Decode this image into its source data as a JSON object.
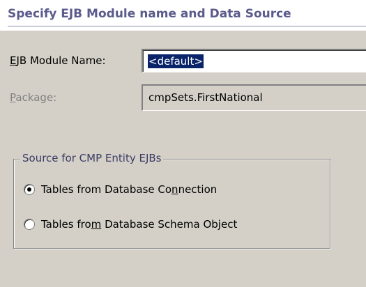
{
  "header": {
    "title": "Specify EJB Module name and Data Source"
  },
  "form": {
    "module_name": {
      "label_first": "E",
      "label_rest": "JB Module Name:",
      "value": "<default>"
    },
    "package": {
      "label_first": "P",
      "label_rest": "ackage:",
      "value": "cmpSets.FirstNational"
    }
  },
  "source_group": {
    "legend": "Source for CMP Entity EJBs",
    "options": [
      {
        "label_before": "Tables from Database Co",
        "label_mnemonic": "n",
        "label_after": "nection",
        "selected": true
      },
      {
        "label_before": "Tables fro",
        "label_mnemonic": "m",
        "label_after": " Database Schema Object",
        "selected": false
      }
    ]
  },
  "colors": {
    "window_bg": "#d4d0c8",
    "header_title": "#5a5a8c",
    "selection_bg": "#0a246a"
  }
}
